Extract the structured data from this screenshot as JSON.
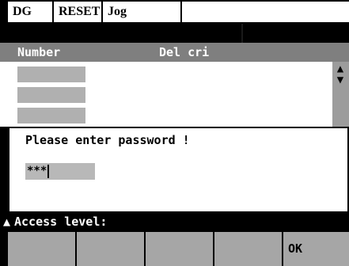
{
  "status_bar": {
    "channel": "DG",
    "reset_state": "RESET",
    "mode": "Jog",
    "message": ""
  },
  "table": {
    "headers": {
      "number": "Number",
      "description": "Del cri"
    },
    "row_count": 3
  },
  "scrollbar": {
    "up_arrow": "▲",
    "down_arrow": "▼"
  },
  "dialog": {
    "message": "Please enter password !",
    "password_value": "***"
  },
  "access_bar": {
    "arrow": "▲",
    "label": "Access level:"
  },
  "softkeys": [
    "",
    "",
    "",
    "",
    "OK"
  ],
  "colors": {
    "header_bg": "#7f7f7f",
    "field_bg": "#b8b8b8",
    "softkey_bg": "#a6a6a6"
  }
}
